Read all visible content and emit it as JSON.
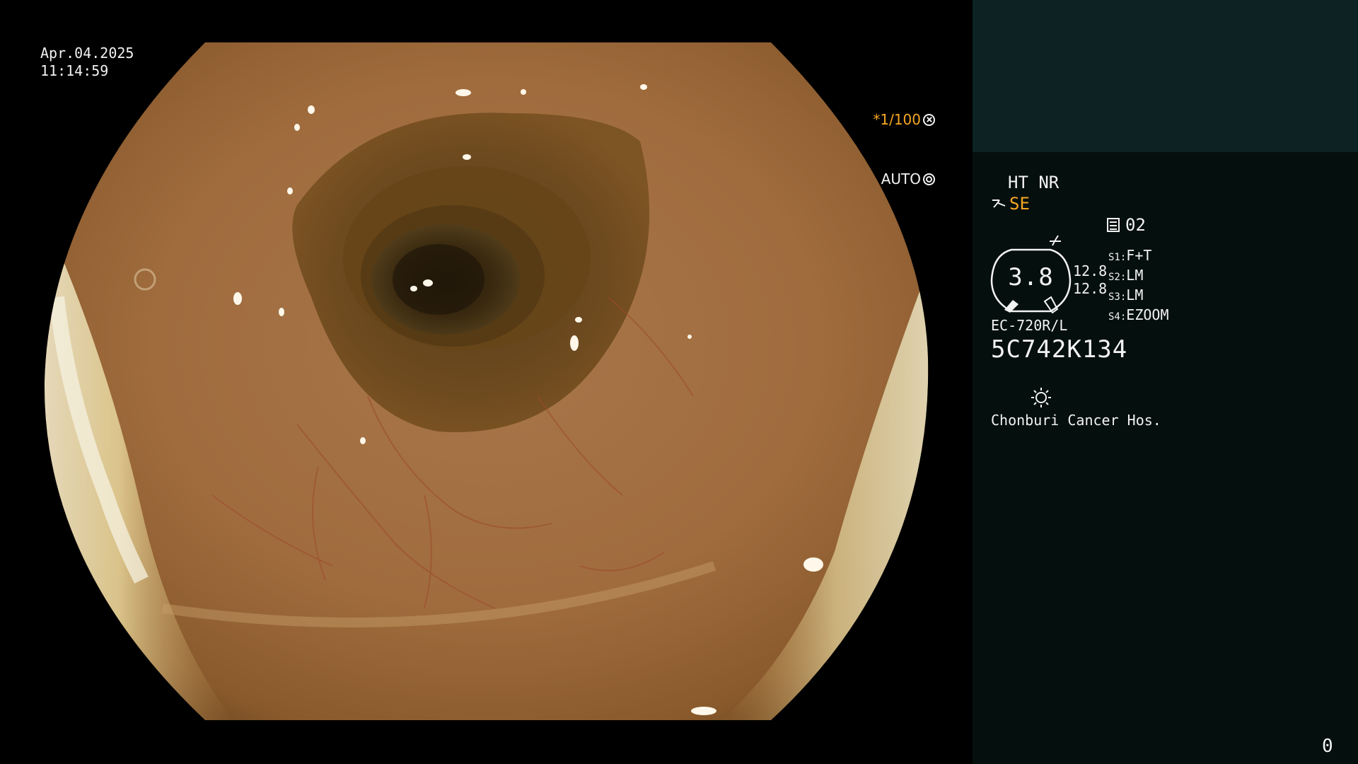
{
  "scope_view": {
    "date": "Apr.04.2025",
    "time": "11:14:59",
    "shutter": "*1/100",
    "iris_mode": "AUTO",
    "shutter_icon": "aperture-icon",
    "iris_icon": "ring-icon"
  },
  "panel": {
    "enhance_mode": "HT NR",
    "structure_mode": "SE",
    "memory_channel": "02",
    "gauge_value": "3.8",
    "gauge_side_values": [
      "12.8",
      "12.8"
    ],
    "switches": [
      {
        "key": "S1:",
        "value": "F+T"
      },
      {
        "key": "S2:",
        "value": "LM"
      },
      {
        "key": "S3:",
        "value": "LM"
      },
      {
        "key": "S4:",
        "value": "EZOOM"
      }
    ],
    "scope_model": "EC-720R/L",
    "serial_number": "5C742K134",
    "hospital": "Chonburi Cancer Hos.",
    "frame_counter": "0"
  },
  "colors": {
    "accent": "#f5a623",
    "panel_bg": "#050f0e",
    "thumb_bg": "#0c2223",
    "text": "#f2f2f2"
  }
}
